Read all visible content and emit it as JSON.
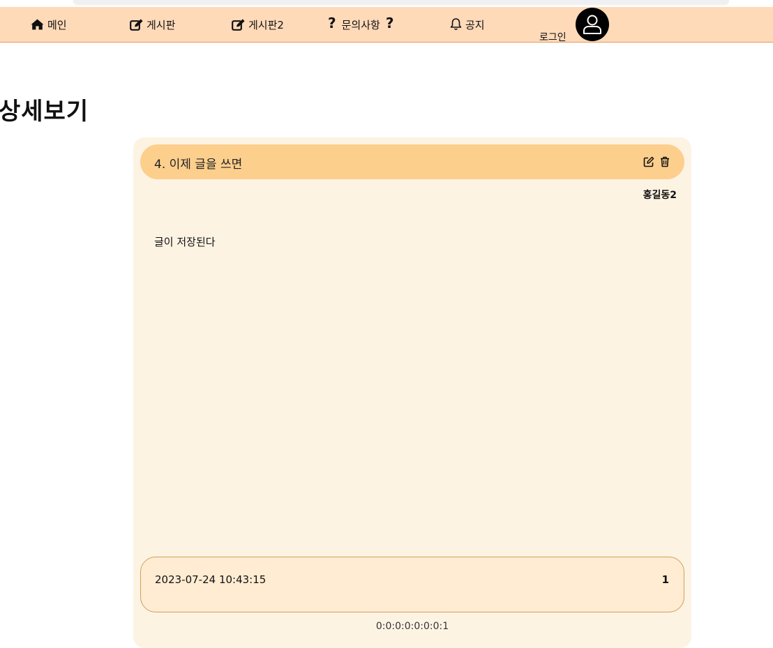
{
  "nav": {
    "items": [
      {
        "label": "메인",
        "icon": "home-icon"
      },
      {
        "label": "게시판",
        "icon": "edit-icon"
      },
      {
        "label": "게시판2",
        "icon": "edit-icon"
      },
      {
        "label": "문의사항",
        "icon": "question-icon",
        "suffix": "?",
        "prefix": "?"
      },
      {
        "label": "공지",
        "icon": "bell-icon"
      }
    ],
    "login_label": "로그인",
    "avatar_icon": "user-icon"
  },
  "page": {
    "title": "상세보기"
  },
  "post": {
    "title": "4. 이제 글을 쓰면",
    "author": "홍길동2",
    "content": "글이 저장된다",
    "date": "2023-07-24 10:43:15",
    "views": "1",
    "ip": "0:0:0:0:0:0:0:1",
    "actions": {
      "edit_icon": "edit-icon",
      "delete_icon": "trash-icon"
    }
  },
  "colors": {
    "navbar": "#ffdab9",
    "card": "#fdf3e3",
    "card_header": "#fdcf8d",
    "card_footer": "#ffecd2"
  }
}
